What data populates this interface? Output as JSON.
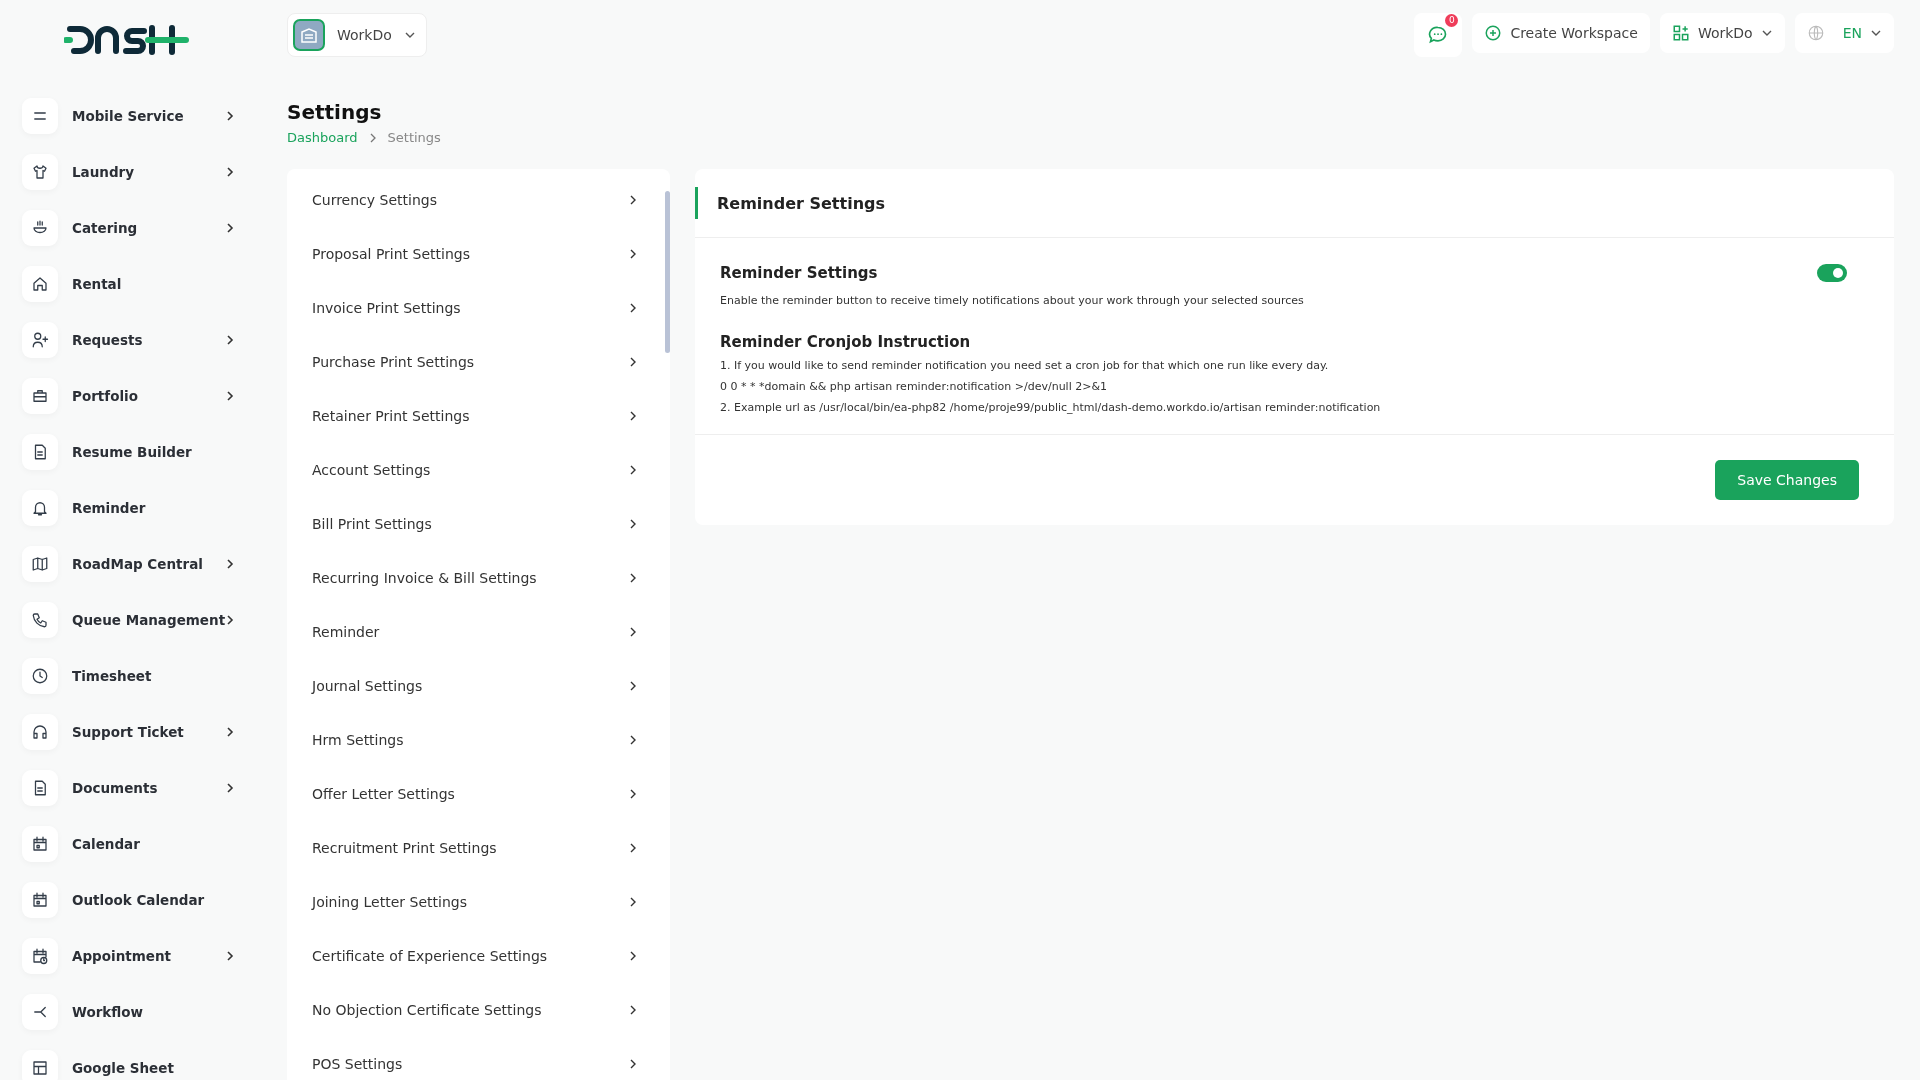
{
  "header": {
    "workspace": "WorkDo",
    "notifications_count": "0",
    "create_workspace": "Create Workspace",
    "workspace_menu": "WorkDo",
    "language": "EN"
  },
  "sidebar": {
    "items": [
      {
        "label": "Mobile Service",
        "has_submenu": true
      },
      {
        "label": "Laundry",
        "has_submenu": true
      },
      {
        "label": "Catering",
        "has_submenu": true
      },
      {
        "label": "Rental",
        "has_submenu": false
      },
      {
        "label": "Requests",
        "has_submenu": true
      },
      {
        "label": "Portfolio",
        "has_submenu": true
      },
      {
        "label": "Resume Builder",
        "has_submenu": false
      },
      {
        "label": "Reminder",
        "has_submenu": false
      },
      {
        "label": "RoadMap Central",
        "has_submenu": true
      },
      {
        "label": "Queue Management",
        "has_submenu": true
      },
      {
        "label": "Timesheet",
        "has_submenu": false
      },
      {
        "label": "Support Ticket",
        "has_submenu": true
      },
      {
        "label": "Documents",
        "has_submenu": true
      },
      {
        "label": "Calendar",
        "has_submenu": false
      },
      {
        "label": "Outlook Calendar",
        "has_submenu": false
      },
      {
        "label": "Appointment",
        "has_submenu": true
      },
      {
        "label": "Workflow",
        "has_submenu": false
      },
      {
        "label": "Google Sheet",
        "has_submenu": false
      }
    ]
  },
  "page": {
    "title": "Settings",
    "breadcrumb": [
      "Dashboard",
      "Settings"
    ]
  },
  "settings_menu": {
    "items": [
      "Currency Settings",
      "Proposal Print Settings",
      "Invoice Print Settings",
      "Purchase Print Settings",
      "Retainer Print Settings",
      "Account Settings",
      "Bill Print Settings",
      "Recurring Invoice & Bill Settings",
      "Reminder",
      "Journal Settings",
      "Hrm Settings",
      "Offer Letter Settings",
      "Recruitment Print Settings",
      "Joining Letter Settings",
      "Certificate of Experience Settings",
      "No Objection Certificate Settings",
      "POS Settings"
    ]
  },
  "card": {
    "title": "Reminder Settings",
    "setting_label": "Reminder Settings",
    "toggle_on": true,
    "description": "Enable the reminder button to receive timely notifications about your work through your selected sources",
    "instruction_title": "Reminder Cronjob Instruction",
    "instructions": [
      "1. If you would like to send reminder notification you need set a cron job for that which one run like every day.",
      "0 0 * * *domain && php artisan reminder:notification >/dev/null 2>&1",
      "2. Example url as /usr/local/bin/ea-php82 /home/proje99/public_html/dash-demo.workdo.io/artisan reminder:notification"
    ],
    "save_button": "Save Changes"
  }
}
